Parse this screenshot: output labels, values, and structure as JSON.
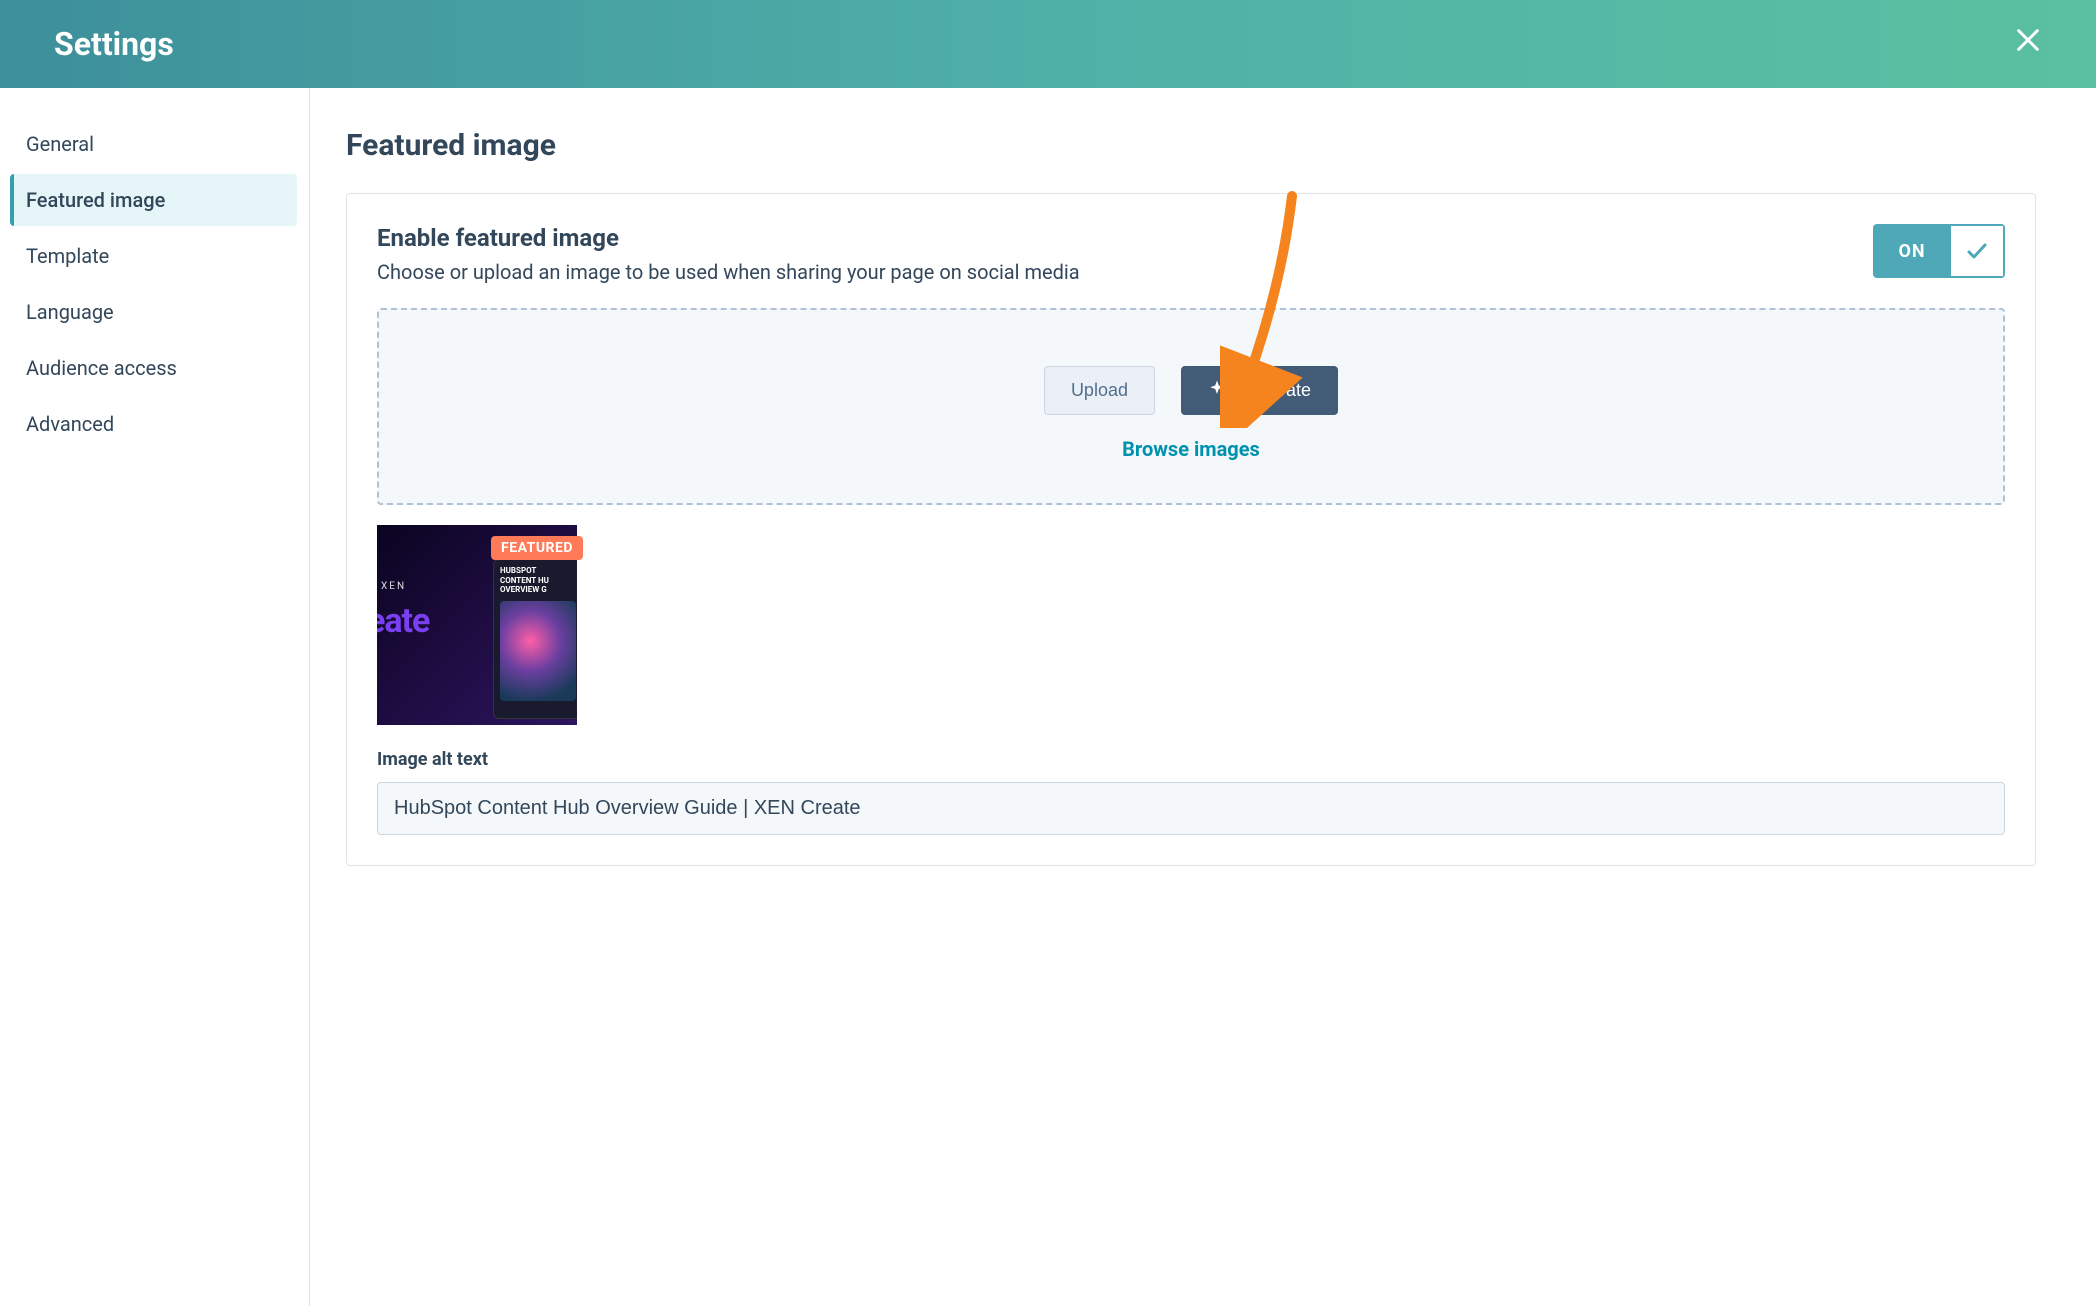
{
  "header": {
    "title": "Settings"
  },
  "sidebar": {
    "items": [
      {
        "label": "General"
      },
      {
        "label": "Featured image"
      },
      {
        "label": "Template"
      },
      {
        "label": "Language"
      },
      {
        "label": "Audience access"
      },
      {
        "label": "Advanced"
      }
    ],
    "activeIndex": 1
  },
  "main": {
    "title": "Featured image",
    "enable": {
      "title": "Enable featured image",
      "description": "Choose or upload an image to be used when sharing your page on social media",
      "toggleLabel": "ON"
    },
    "dropzone": {
      "uploadLabel": "Upload",
      "generateLabel": "Generate",
      "browseLabel": "Browse images"
    },
    "thumbnail": {
      "badge": "FEATURED",
      "brandSmall": "XEN",
      "brandBig": "eate",
      "panelLine1": "HUBSPOT",
      "panelLine2": "CONTENT HU",
      "panelLine3": "OVERVIEW G"
    },
    "altField": {
      "label": "Image alt text",
      "value": "HubSpot Content Hub Overview Guide | XEN Create"
    }
  }
}
